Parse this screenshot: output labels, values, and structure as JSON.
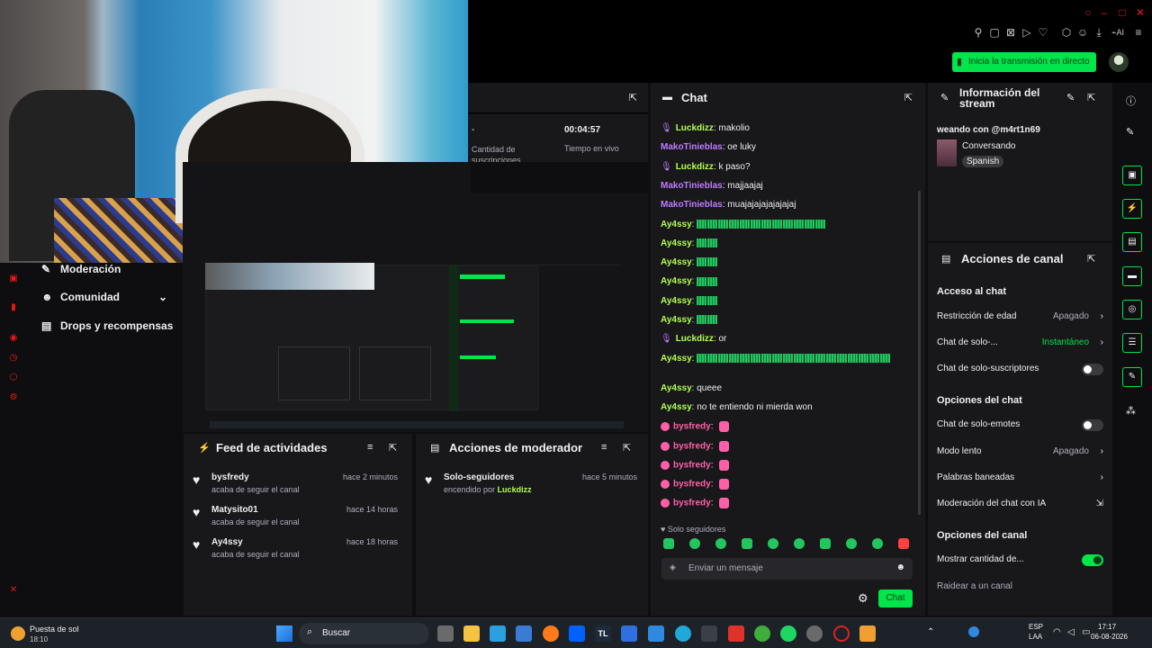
{
  "top": {
    "go_live_label": "Inicia la transmisión en directo",
    "icons": [
      "pin-icon",
      "popout-icon",
      "close-x-icon",
      "play-icon",
      "heart-icon",
      "extensions-icon",
      "profile-icon",
      "download-icon",
      "ai-icon",
      "menu-icon"
    ]
  },
  "left_nav": {
    "items": [
      {
        "label": "Moderación",
        "icon": "wrench-icon"
      },
      {
        "label": "Comunidad",
        "icon": "people-icon"
      },
      {
        "label": "Drops y recompensas",
        "icon": "gift-icon"
      }
    ]
  },
  "stats": {
    "sub_count_label": "Cantidad de suscripciones",
    "dash": "-",
    "live_time": "00:04:57",
    "live_time_label": "Tiempo en vivo"
  },
  "activity_feed": {
    "title": "Feed de actividades",
    "items": [
      {
        "name": "bysfredy",
        "sub": "acaba de seguir el canal",
        "time": "hace 2 minutos"
      },
      {
        "name": "Matysito01",
        "sub": "acaba de seguir el canal",
        "time": "hace 14 horas"
      },
      {
        "name": "Ay4ssy",
        "sub": "acaba de seguir el canal",
        "time": "hace 18 horas"
      }
    ]
  },
  "mod_actions": {
    "title": "Acciones de moderador",
    "items": [
      {
        "name": "Solo-seguidores",
        "sub_prefix": "encendido por",
        "sub_user": "Luckdizz",
        "time": "hace 5 minutos"
      }
    ]
  },
  "chat": {
    "title": "Chat",
    "lines": [
      {
        "user": "Luckdizz",
        "msg": "makolio",
        "color": "green",
        "icon": "mic"
      },
      {
        "user": "MakoTinieblas",
        "msg": "oe luky",
        "color": "purple",
        "icon": ""
      },
      {
        "user": "Luckdizz",
        "msg": "k paso?",
        "color": "green",
        "icon": "mic"
      },
      {
        "user": "MakoTinieblas",
        "msg": "majjaajaj",
        "color": "purple",
        "icon": ""
      },
      {
        "user": "MakoTinieblas",
        "msg": "muajajajajajajajaj",
        "color": "purple",
        "icon": ""
      },
      {
        "user": "Ay4ssy",
        "msg": "",
        "color": "green",
        "icon": "",
        "emotes": 12
      },
      {
        "user": "Ay4ssy",
        "msg": "",
        "color": "green",
        "icon": "",
        "emotes": 2
      },
      {
        "user": "Ay4ssy",
        "msg": "",
        "color": "green",
        "icon": "",
        "emotes": 2
      },
      {
        "user": "Ay4ssy",
        "msg": "",
        "color": "green",
        "icon": "",
        "emotes": 2
      },
      {
        "user": "Ay4ssy",
        "msg": "",
        "color": "green",
        "icon": "",
        "emotes": 2
      },
      {
        "user": "Ay4ssy",
        "msg": "",
        "color": "green",
        "icon": "",
        "emotes": 2
      },
      {
        "user": "Luckdizz",
        "msg": "or",
        "color": "green",
        "icon": "mic"
      },
      {
        "user": "Ay4ssy",
        "msg": "",
        "color": "green",
        "icon": "",
        "emotes": 18
      },
      {
        "user": "Ay4ssy",
        "msg": "queee",
        "color": "green",
        "icon": ""
      },
      {
        "user": "Ay4ssy",
        "msg": "no te entiendo ni mierda won",
        "color": "green",
        "icon": ""
      },
      {
        "user": "bysfredy",
        "msg": "",
        "color": "pink",
        "icon": "sub"
      },
      {
        "user": "bysfredy",
        "msg": "",
        "color": "pink",
        "icon": "sub"
      },
      {
        "user": "bysfredy",
        "msg": "",
        "color": "pink",
        "icon": "sub"
      },
      {
        "user": "bysfredy",
        "msg": "",
        "color": "pink",
        "icon": "sub"
      },
      {
        "user": "bysfredy",
        "msg": "",
        "color": "pink",
        "icon": "sub"
      }
    ],
    "mode_label": "Solo seguidores",
    "input_placeholder": "Enviar un mensaje",
    "send_label": "Chat"
  },
  "stream_info": {
    "title": "Información del stream",
    "stream_title": "weando con @m4rt1n69",
    "category": "Conversando",
    "tag": "Spanish"
  },
  "channel_actions": {
    "title": "Acciones de canal",
    "sections": {
      "chat_access": "Acceso al chat",
      "chat_options": "Opciones del chat",
      "channel_options": "Opciones del canal"
    },
    "rows": {
      "age": {
        "label": "Restricción de edad",
        "value": "Apagado"
      },
      "solo": {
        "label": "Chat de solo-...",
        "value": "Instantáneo"
      },
      "subs": {
        "label": "Chat de solo-suscriptores"
      },
      "emotes": {
        "label": "Chat de solo-emotes"
      },
      "slow": {
        "label": "Modo lento",
        "value": "Apagado"
      },
      "banned": {
        "label": "Palabras baneadas"
      },
      "ai": {
        "label": "Moderación del chat con IA"
      },
      "show_count": {
        "label": "Mostrar cantidad de..."
      },
      "raid": {
        "label": "Raidear a un canal"
      }
    }
  },
  "taskbar": {
    "weather": "Puesta de sol",
    "weather_time": "18:10",
    "search": "Buscar",
    "lang": "ESP",
    "lang2": "LAA",
    "time": "17:17",
    "date": "06-08-2026"
  },
  "colors": {
    "accent": "#00e54a",
    "bg": "#0e0e10",
    "panel": "#18181b",
    "purple": "#bf7bff",
    "pink": "#ff5fa8"
  }
}
